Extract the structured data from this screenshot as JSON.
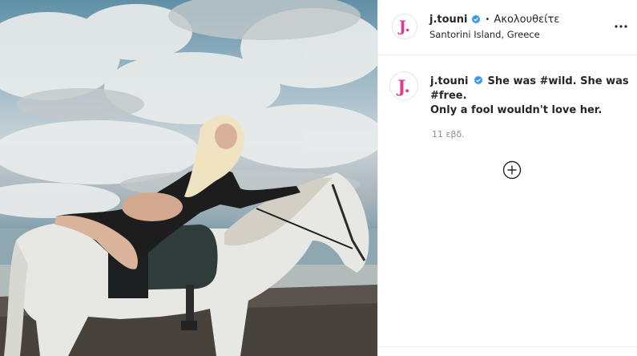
{
  "post": {
    "username": "j.touni",
    "avatar_letter": "J.",
    "follow_status": "Ακολουθείτε",
    "location": "Santorini Island, Greece",
    "caption": {
      "line1": "She was #wild. She was #free.",
      "line2": "Only a fool wouldn't love her."
    },
    "time_ago": "11 εβδ."
  },
  "icons": {
    "verified": "verified-badge-icon",
    "more": "more-options-icon",
    "load_more": "load-more-comments-icon"
  },
  "colors": {
    "brand_avatar": "#e4378d",
    "verified_blue": "#3897f0",
    "secondary_text": "#8e8e8e"
  },
  "image": {
    "description_free": true
  }
}
